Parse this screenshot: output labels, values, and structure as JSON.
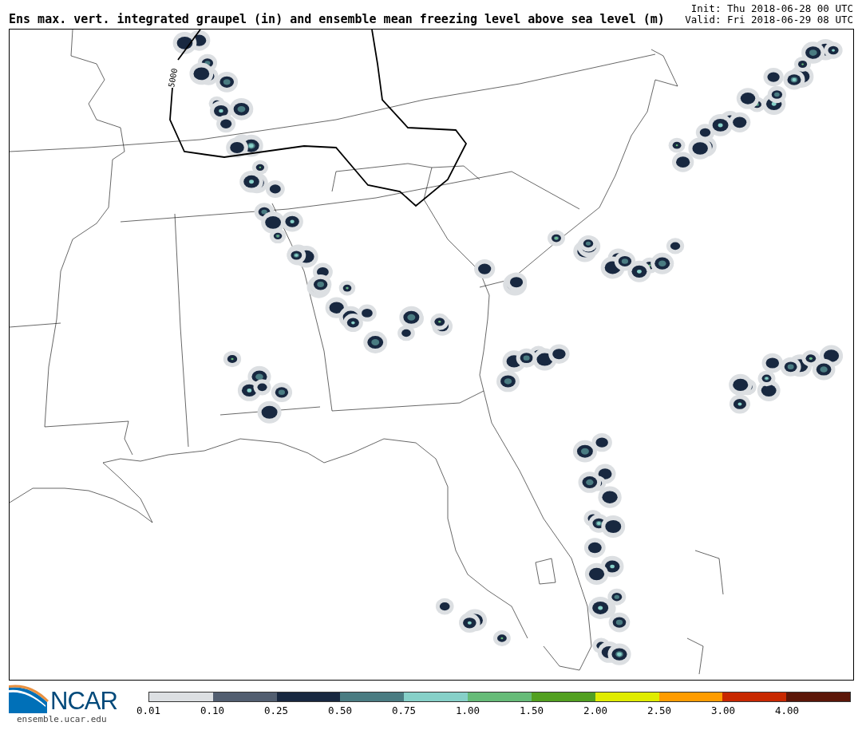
{
  "title": "Ens max. vert. integrated graupel (in) and ensemble mean freezing level above sea level (m)",
  "init": "Init: Thu 2018-06-28 00 UTC",
  "valid": "Valid: Fri 2018-06-29 08 UTC",
  "map": {
    "contour_label": "5000"
  },
  "colorbar": [
    {
      "label": "0.01",
      "color": "#dcdfe2"
    },
    {
      "label": "0.10",
      "color": "#525e70"
    },
    {
      "label": "0.25",
      "color": "#182840"
    },
    {
      "label": "0.50",
      "color": "#4a7c82"
    },
    {
      "label": "0.75",
      "color": "#86d0c8"
    },
    {
      "label": "1.00",
      "color": "#66bb78"
    },
    {
      "label": "1.50",
      "color": "#52a020"
    },
    {
      "label": "2.00",
      "color": "#e0ec00"
    },
    {
      "label": "2.50",
      "color": "#ff9c00"
    },
    {
      "label": "3.00",
      "color": "#c82800"
    },
    {
      "label": "4.00",
      "color": "#5c1608"
    }
  ],
  "logo": {
    "name": "NCAR",
    "url": "ensemble.ucar.edu"
  }
}
